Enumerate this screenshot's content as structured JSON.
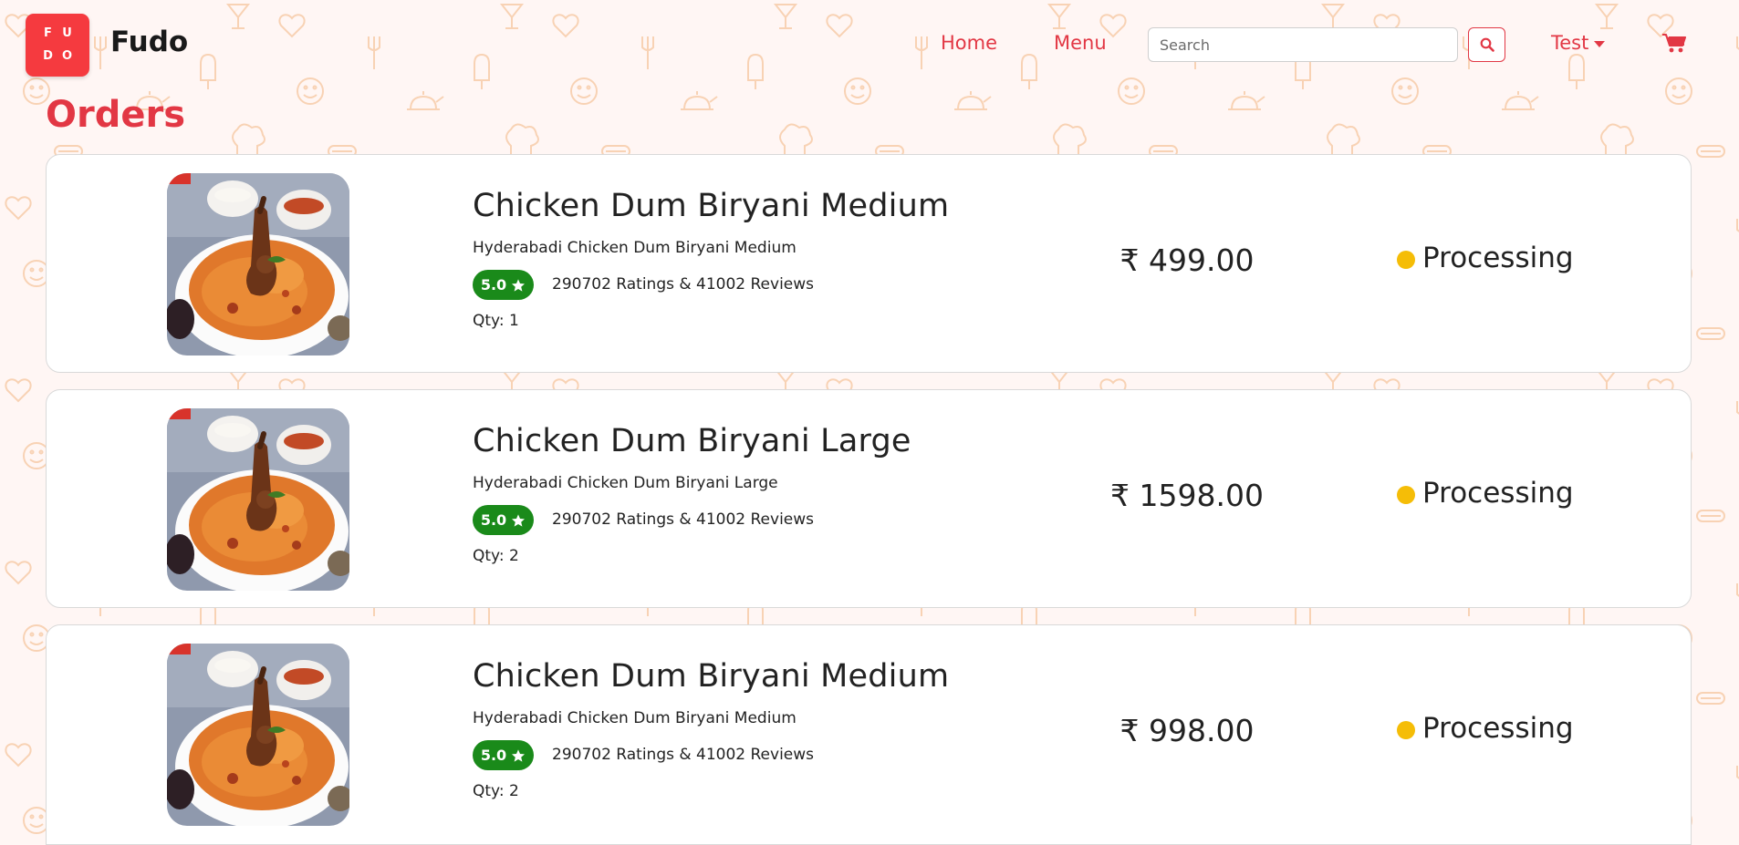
{
  "brand": {
    "logo_letters": [
      "F",
      "U",
      "D",
      "O"
    ],
    "name": "Fudo",
    "logo_color": "#f53a3f"
  },
  "nav": {
    "home_label": "Home",
    "menu_label": "Menu",
    "search_placeholder": "Search",
    "search_value": "",
    "user_label": "Test",
    "accent_color": "#e23744"
  },
  "page": {
    "title": "Orders"
  },
  "orders": [
    {
      "title": "Chicken Dum Biryani Medium",
      "subtitle": "Hyderabadi Chicken Dum Biryani Medium",
      "rating": "5.0",
      "ratings_text": "290702 Ratings & 41002 Reviews",
      "qty": "Qty: 1",
      "price": "₹ 499.00",
      "status": "Processing",
      "status_color": "#f5bd07"
    },
    {
      "title": "Chicken Dum Biryani Large",
      "subtitle": "Hyderabadi Chicken Dum Biryani Large",
      "rating": "5.0",
      "ratings_text": "290702 Ratings & 41002 Reviews",
      "qty": "Qty: 2",
      "price": "₹ 1598.00",
      "status": "Processing",
      "status_color": "#f5bd07"
    },
    {
      "title": "Chicken Dum Biryani Medium",
      "subtitle": "Hyderabadi Chicken Dum Biryani Medium",
      "rating": "5.0",
      "ratings_text": "290702 Ratings & 41002 Reviews",
      "qty": "Qty: 2",
      "price": "₹ 998.00",
      "status": "Processing",
      "status_color": "#f5bd07"
    }
  ]
}
